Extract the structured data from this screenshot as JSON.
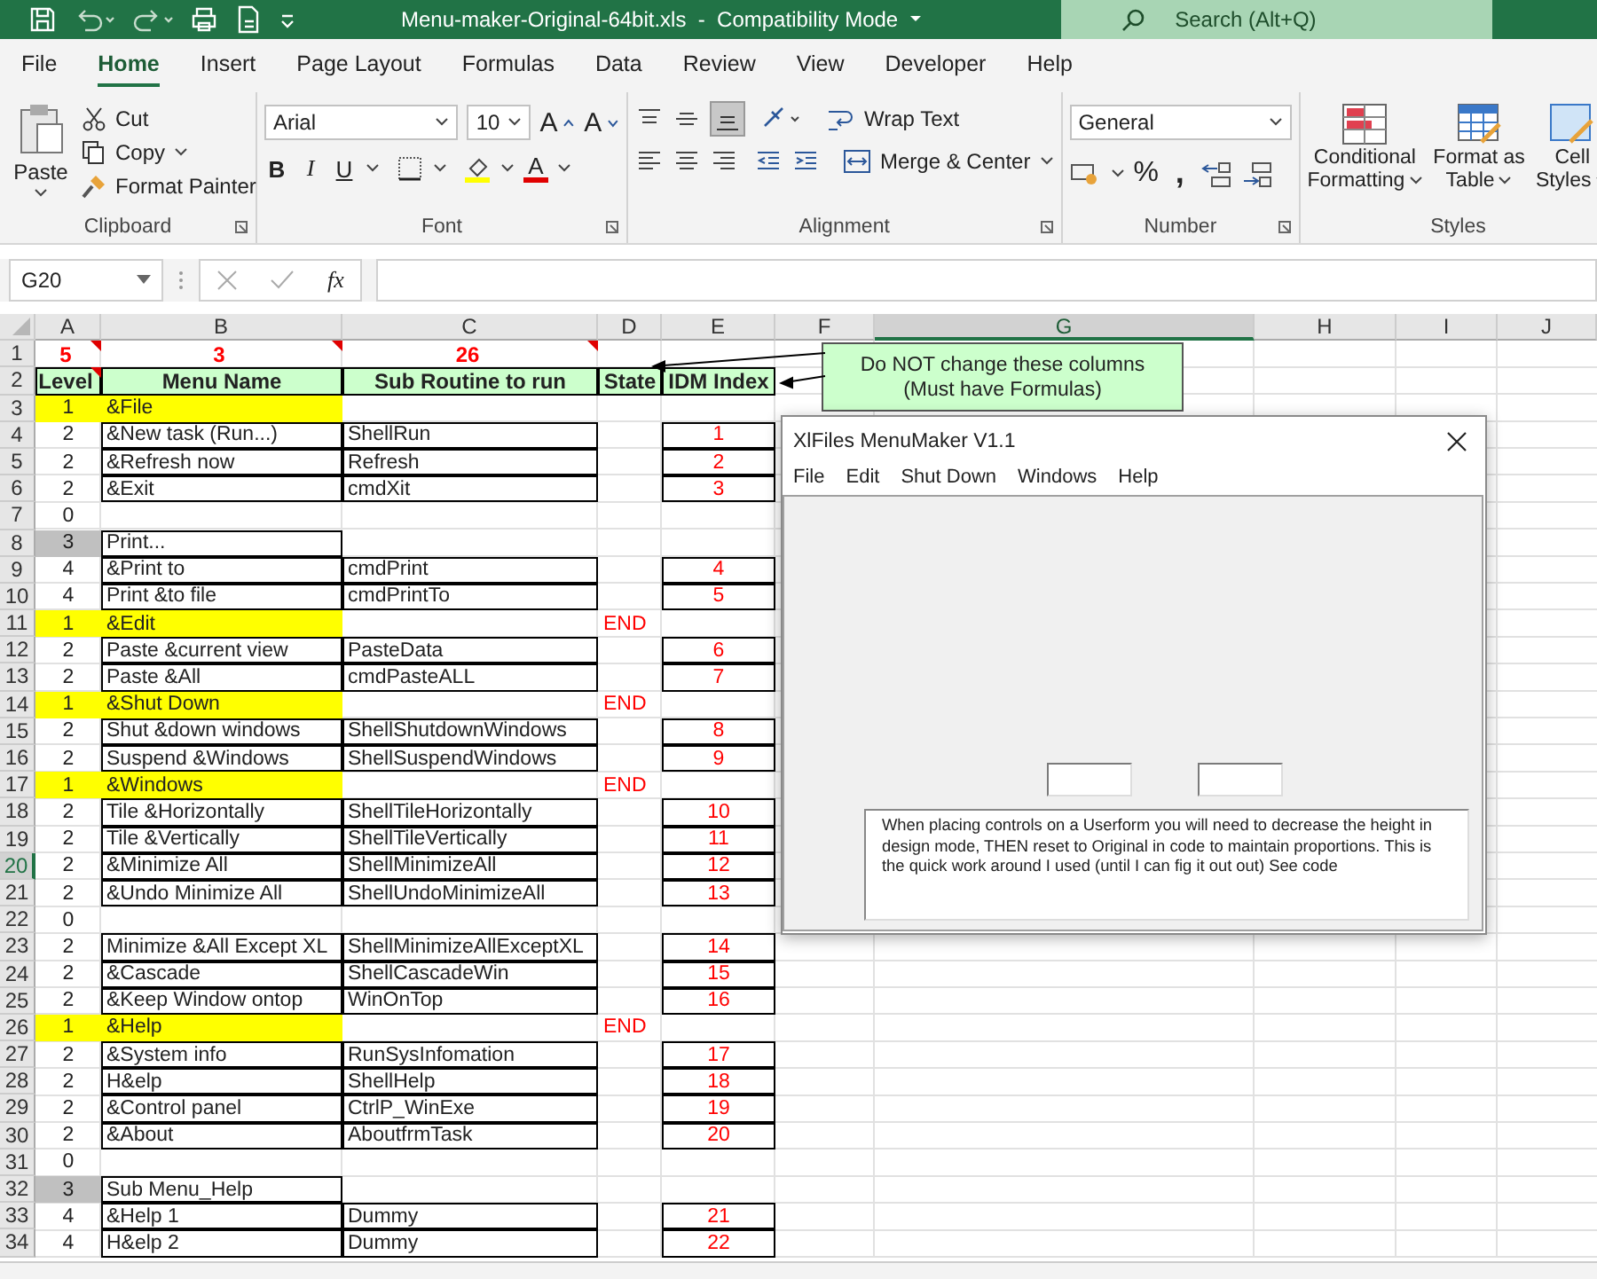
{
  "title_bar": {
    "document_title": "Menu-maker-Original-64bit.xls  -  Compatibility Mode",
    "search": {
      "placeholder": "Search (Alt+Q)"
    }
  },
  "menu_tabs": [
    {
      "label": "File",
      "selected": false
    },
    {
      "label": "Home",
      "selected": true
    },
    {
      "label": "Insert",
      "selected": false
    },
    {
      "label": "Page Layout",
      "selected": false
    },
    {
      "label": "Formulas",
      "selected": false
    },
    {
      "label": "Data",
      "selected": false
    },
    {
      "label": "Review",
      "selected": false
    },
    {
      "label": "View",
      "selected": false
    },
    {
      "label": "Developer",
      "selected": false
    },
    {
      "label": "Help",
      "selected": false
    }
  ],
  "ribbon": {
    "clipboard": {
      "label": "Clipboard",
      "paste": "Paste",
      "cut": "Cut",
      "copy": "Copy",
      "format_painter": "Format Painter"
    },
    "font": {
      "label": "Font",
      "font_name": "Arial",
      "font_size": "10",
      "grow": "A",
      "shrink": "A",
      "bold": "B",
      "italic": "I",
      "underline": "U",
      "font_color": "A"
    },
    "alignment": {
      "label": "Alignment",
      "wrap_text": "Wrap Text",
      "merge_center": "Merge & Center"
    },
    "number": {
      "label": "Number",
      "format": "General",
      "percent": "%",
      "comma": ","
    },
    "styles": {
      "label": "Styles",
      "buttons": [
        {
          "kind": "conditional",
          "lines": [
            "Conditional",
            "Formatting"
          ]
        },
        {
          "kind": "table",
          "lines": [
            "Format as",
            "Table"
          ]
        },
        {
          "kind": "cell",
          "lines": [
            "Cell",
            "Styles"
          ]
        }
      ]
    }
  },
  "formula_bar": {
    "name_box": "G20",
    "function_label": "fx"
  },
  "sheet": {
    "columns": [
      {
        "label": "A",
        "selected": false
      },
      {
        "label": "B",
        "selected": false
      },
      {
        "label": "C",
        "selected": false
      },
      {
        "label": "D",
        "selected": false
      },
      {
        "label": "E",
        "selected": false
      },
      {
        "label": "F",
        "selected": false
      },
      {
        "label": "G",
        "selected": true
      },
      {
        "label": "H",
        "selected": false
      },
      {
        "label": "I",
        "selected": false
      },
      {
        "label": "J",
        "selected": false
      }
    ],
    "rows": [
      {
        "n": "1",
        "kind": "counts",
        "selected": false,
        "level": "5",
        "name": "3",
        "sub": "26",
        "comment_marks": [
          true,
          true,
          true,
          false,
          false
        ]
      },
      {
        "n": "2",
        "kind": "header",
        "selected": false,
        "level": "Level",
        "name": "Menu Name",
        "sub": "Sub Routine to run",
        "state": "State",
        "idm": "IDM Index",
        "comment_marks": [
          true,
          false,
          false,
          false,
          false
        ]
      },
      {
        "n": "3",
        "kind": "top",
        "selected": false,
        "level": "1",
        "name": "&File"
      },
      {
        "n": "4",
        "kind": "item",
        "selected": false,
        "level": "2",
        "name": "&New task (Run...)",
        "sub": "ShellRun",
        "idm": "1"
      },
      {
        "n": "5",
        "kind": "item",
        "selected": false,
        "level": "2",
        "name": "&Refresh now",
        "sub": "Refresh",
        "idm": "2"
      },
      {
        "n": "6",
        "kind": "item",
        "selected": false,
        "level": "2",
        "name": "&Exit",
        "sub": "cmdXit",
        "idm": "3"
      },
      {
        "n": "7",
        "kind": "sep",
        "selected": false,
        "level": "0"
      },
      {
        "n": "8",
        "kind": "group",
        "selected": false,
        "level": "3",
        "name": "Print..."
      },
      {
        "n": "9",
        "kind": "item",
        "selected": false,
        "level": "4",
        "name": "&Print to",
        "sub": "cmdPrint",
        "idm": "4"
      },
      {
        "n": "10",
        "kind": "item",
        "selected": false,
        "level": "4",
        "name": "Print &to file",
        "sub": "cmdPrintTo",
        "idm": "5"
      },
      {
        "n": "11",
        "kind": "top",
        "selected": false,
        "level": "1",
        "name": "&Edit",
        "state": "END"
      },
      {
        "n": "12",
        "kind": "item",
        "selected": false,
        "level": "2",
        "name": "Paste &current view",
        "sub": "PasteData",
        "idm": "6"
      },
      {
        "n": "13",
        "kind": "item",
        "selected": false,
        "level": "2",
        "name": "Paste &All",
        "sub": "cmdPasteALL",
        "idm": "7"
      },
      {
        "n": "14",
        "kind": "top",
        "selected": false,
        "level": "1",
        "name": "&Shut Down",
        "state": "END"
      },
      {
        "n": "15",
        "kind": "item",
        "selected": false,
        "level": "2",
        "name": "Shut &down windows",
        "sub": "ShellShutdownWindows",
        "idm": "8"
      },
      {
        "n": "16",
        "kind": "item",
        "selected": false,
        "level": "2",
        "name": "Suspend &Windows",
        "sub": "ShellSuspendWindows",
        "idm": "9"
      },
      {
        "n": "17",
        "kind": "top",
        "selected": false,
        "level": "1",
        "name": "&Windows",
        "state": "END"
      },
      {
        "n": "18",
        "kind": "item",
        "selected": false,
        "level": "2",
        "name": "Tile &Horizontally",
        "sub": "ShellTileHorizontally",
        "idm": "10"
      },
      {
        "n": "19",
        "kind": "item",
        "selected": false,
        "level": "2",
        "name": "Tile &Vertically",
        "sub": "ShellTileVertically",
        "idm": "11"
      },
      {
        "n": "20",
        "kind": "item",
        "selected": true,
        "level": "2",
        "name": "&Minimize All",
        "sub": "ShellMinimizeAll",
        "idm": "12"
      },
      {
        "n": "21",
        "kind": "item",
        "selected": false,
        "level": "2",
        "name": "&Undo Minimize All",
        "sub": "ShellUndoMinimizeAll",
        "idm": "13"
      },
      {
        "n": "22",
        "kind": "sep",
        "selected": false,
        "level": "0"
      },
      {
        "n": "23",
        "kind": "item",
        "selected": false,
        "level": "2",
        "name": "Minimize &All Except XL",
        "sub": "ShellMinimizeAllExceptXL",
        "idm": "14"
      },
      {
        "n": "24",
        "kind": "item",
        "selected": false,
        "level": "2",
        "name": "&Cascade",
        "sub": "ShellCascadeWin",
        "idm": "15"
      },
      {
        "n": "25",
        "kind": "item",
        "selected": false,
        "level": "2",
        "name": "&Keep Window ontop",
        "sub": "WinOnTop",
        "idm": "16"
      },
      {
        "n": "26",
        "kind": "top",
        "selected": false,
        "level": "1",
        "name": "&Help",
        "state": "END"
      },
      {
        "n": "27",
        "kind": "item",
        "selected": false,
        "level": "2",
        "name": "&System info",
        "sub": "RunSysInfomation",
        "idm": "17"
      },
      {
        "n": "28",
        "kind": "item",
        "selected": false,
        "level": "2",
        "name": "H&elp",
        "sub": "ShellHelp",
        "idm": "18"
      },
      {
        "n": "29",
        "kind": "item",
        "selected": false,
        "level": "2",
        "name": "&Control panel",
        "sub": "CtrlP_WinExe",
        "idm": "19"
      },
      {
        "n": "30",
        "kind": "item",
        "selected": false,
        "level": "2",
        "name": "&About",
        "sub": "AboutfrmTask",
        "idm": "20"
      },
      {
        "n": "31",
        "kind": "sep",
        "selected": false,
        "level": "0"
      },
      {
        "n": "32",
        "kind": "group",
        "selected": false,
        "level": "3",
        "name": "Sub Menu_Help"
      },
      {
        "n": "33",
        "kind": "item",
        "selected": false,
        "level": "4",
        "name": "&Help 1",
        "sub": "Dummy",
        "idm": "21"
      },
      {
        "n": "34",
        "kind": "item",
        "selected": false,
        "level": "4",
        "name": "H&elp 2",
        "sub": "Dummy",
        "idm": "22"
      }
    ]
  },
  "callout": {
    "lines": [
      "Do NOT change these columns",
      "(Must have Formulas)"
    ]
  },
  "dialog": {
    "title": "XlFiles MenuMaker V1.1",
    "menu": [
      "File",
      "Edit",
      "Shut Down",
      "Windows",
      "Help"
    ],
    "note": "When placing controls on a Userform you will need to decrease the height in design mode, THEN reset to Original in code to maintain proportions. This is the quick work around I used (until I can fig it out out) See code"
  }
}
